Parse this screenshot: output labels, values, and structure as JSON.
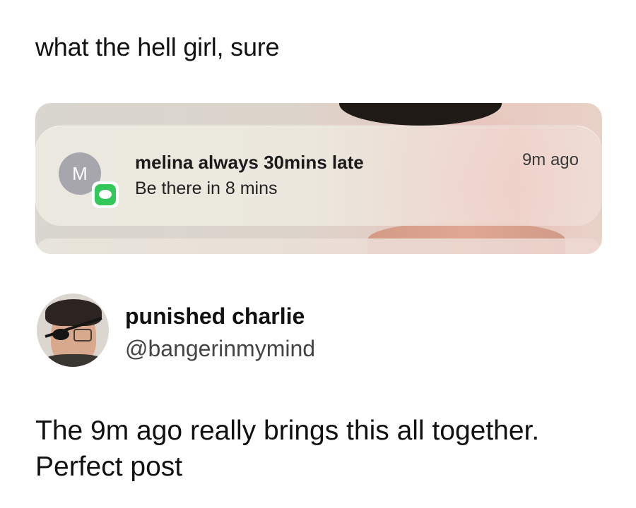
{
  "caption": "what the hell girl, sure",
  "notification": {
    "avatar_letter": "M",
    "title": "melina always 30mins late",
    "body": "Be there in 8 mins",
    "time": "9m ago",
    "app_icon": "messages-icon"
  },
  "reply": {
    "display_name": "punished charlie",
    "handle": "@bangerinmymind",
    "text_line1": "The 9m ago really brings this all together.",
    "text_line2": "Perfect post"
  },
  "colors": {
    "messages_green": "#34c759",
    "avatar_gray": "#a6a6ac"
  }
}
